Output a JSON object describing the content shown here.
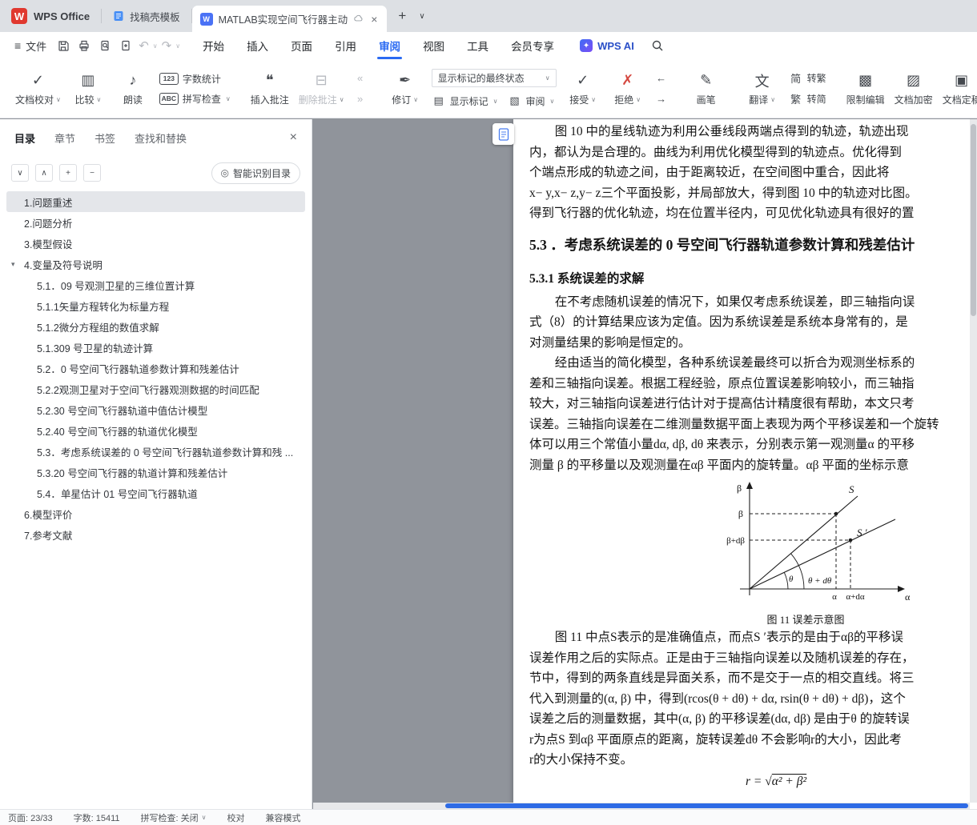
{
  "icons": {
    "app_w": "W",
    "doc_w": "W",
    "ai_spark": "✦",
    "hamburger": "≡",
    "undo": "↶",
    "redo": "↷",
    "caret_down": "∨",
    "caret_up": "∧",
    "plus": "+",
    "minus": "−",
    "close": "×",
    "proofread": "✓",
    "compare": "▥",
    "read_aloud": "♪",
    "word_count": "123",
    "spell_check": "ABC",
    "insert_comment": "❝",
    "delete_comment": "⊟",
    "prev_comment": "«",
    "next_comment": "»",
    "track_changes": "✒",
    "show_markup": "▤",
    "review_pane": "▧",
    "accept": "✓",
    "reject": "✗",
    "prev_change": "←",
    "next_change": "→",
    "brush": "✎",
    "translate": "文",
    "s2t_icon": "简",
    "t2s_icon": "繁",
    "restrict": "▩",
    "encrypt": "▨",
    "finalize": "▣",
    "smart_toc": "◎",
    "toc_caret": "▾"
  },
  "tabbar": {
    "app_name": "WPS Office",
    "tab1": "找稿壳模板",
    "tab2": "MATLAB实现空间飞行器主动"
  },
  "menubar": {
    "file": "文件",
    "tabs": [
      {
        "label": "开始"
      },
      {
        "label": "插入"
      },
      {
        "label": "页面"
      },
      {
        "label": "引用"
      },
      {
        "label": "审阅",
        "active": true
      },
      {
        "label": "视图"
      },
      {
        "label": "工具"
      },
      {
        "label": "会员专享"
      }
    ],
    "wps_ai": "WPS AI"
  },
  "ribbon": {
    "proofread": "文档校对",
    "compare": "比较",
    "read_aloud": "朗读",
    "word_count": "字数统计",
    "spell_check": "拼写检查",
    "insert_comment": "插入批注",
    "delete_comment": "删除批注",
    "track_changes": "修订",
    "markup_state": "显示标记的最终状态",
    "show_markup": "显示标记",
    "review": "审阅",
    "accept": "接受",
    "reject": "拒绝",
    "brush": "画笔",
    "translate": "翻译",
    "s2t": "转繁",
    "t2s": "转简",
    "restrict_edit": "限制编辑",
    "encrypt": "文档加密",
    "finalize": "文档定稿"
  },
  "sidebar": {
    "tabs": [
      {
        "label": "目录",
        "active": true
      },
      {
        "label": "章节"
      },
      {
        "label": "书签"
      },
      {
        "label": "查找和替换"
      }
    ],
    "smart_toc": "智能识别目录",
    "toc": [
      {
        "label": "1.问题重述",
        "level": 1,
        "selected": true
      },
      {
        "label": "2.问题分析",
        "level": 1
      },
      {
        "label": "3.模型假设",
        "level": 1
      },
      {
        "label": "4.变量及符号说明",
        "level": 1,
        "expanded": true
      },
      {
        "label": "5.1．09 号观测卫星的三维位置计算",
        "level": 2
      },
      {
        "label": "5.1.1矢量方程转化为标量方程",
        "level": 2
      },
      {
        "label": "5.1.2微分方程组的数值求解",
        "level": 2
      },
      {
        "label": "5.1.309 号卫星的轨迹计算",
        "level": 2
      },
      {
        "label": "5.2．0 号空间飞行器轨道参数计算和残差估计",
        "level": 2
      },
      {
        "label": "5.2.2观测卫星对于空间飞行器观测数据的时间匹配",
        "level": 2
      },
      {
        "label": "5.2.30 号空间飞行器轨道中值估计模型",
        "level": 2
      },
      {
        "label": "5.2.40 号空间飞行器的轨道优化模型",
        "level": 2
      },
      {
        "label": "5.3．考虑系统误差的 0 号空间飞行器轨道参数计算和残 ...",
        "level": 2
      },
      {
        "label": "5.3.20 号空间飞行器的轨道计算和残差估计",
        "level": 2
      },
      {
        "label": "5.4．单星估计 01 号空间飞行器轨道",
        "level": 2
      },
      {
        "label": "6.模型评价",
        "level": 1
      },
      {
        "label": "7.参考文献",
        "level": 1
      }
    ]
  },
  "document": {
    "para1": [
      "图 10 中的星线轨迹为利用公垂线段两端点得到的轨迹，轨迹出现",
      "内，都认为是合理的。曲线为利用优化模型得到的轨迹点。优化得到",
      "个端点形成的轨迹之间，由于距离较近，在空间图中重合，因此将",
      "x− y,x− z,y− z三个平面投影，并局部放大，得到图 10 中的轨迹对比图。",
      "得到飞行器的优化轨迹，均在位置半径内，可见优化轨迹具有很好的置"
    ],
    "h53": "5.3 ．考虑系统误差的 0 号空间飞行器轨道参数计算和残差估计",
    "h531": "5.3.1 系统误差的求解",
    "para2": [
      "在不考虑随机误差的情况下，如果仅考虑系统误差，即三轴指向误",
      "式（8）的计算结果应该为定值。因为系统误差是系统本身常有的，是",
      "对测量结果的影响是恒定的。"
    ],
    "para3": [
      "经由适当的简化模型，各种系统误差最终可以折合为观测坐标系的",
      "差和三轴指向误差。根据工程经验，原点位置误差影响较小，而三轴指",
      "较大，对三轴指向误差进行估计对于提高估计精度很有帮助，本文只考",
      "误差。三轴指向误差在二维测量数据平面上表现为两个平移误差和一个旋转",
      "体可以用三个常值小量dα, dβ, dθ 来表示，分别表示第一观测量α 的平移",
      "测量 β 的平移量以及观测量在αβ 平面内的旋转量。αβ 平面的坐标示意"
    ],
    "figure": {
      "caption": "图 11 误差示意图",
      "labels": {
        "beta_axis": "β",
        "alpha_axis": "α",
        "S": "S",
        "S_prime": "S ′",
        "beta": "β",
        "beta_db": "β+dβ",
        "alpha": "α",
        "alpha_da": "α+dα",
        "theta": "θ",
        "theta_dt": "θ + dθ"
      }
    },
    "para4": [
      "图 11 中点S表示的是准确值点，而点S ′表示的是由于αβ的平移误",
      "误差作用之后的实际点。正是由于三轴指向误差以及随机误差的存在，",
      "节中，得到的两条直线是异面关系，而不是交于一点的相交直线。将三",
      "代入到测量的(α, β) 中，得到(rcos(θ + dθ) + dα, rsin(θ + dθ) + dβ)，这个",
      "误差之后的测量数据，其中(α, β) 的平移误差(dα, dβ) 是由于θ 的旋转误",
      "r为点S 到αβ 平面原点的距离，旋转误差dθ 不会影响r的大小，因此考",
      "r的大小保持不变。"
    ],
    "formula": {
      "lead": "r = ",
      "radical": "√",
      "radicand": "α² + β²"
    }
  },
  "statusbar": {
    "page": "页面: 23/33",
    "words": "字数: 15411",
    "spell": "拼写检查: 关闭",
    "proofread": "校对",
    "compat": "兼容模式"
  }
}
